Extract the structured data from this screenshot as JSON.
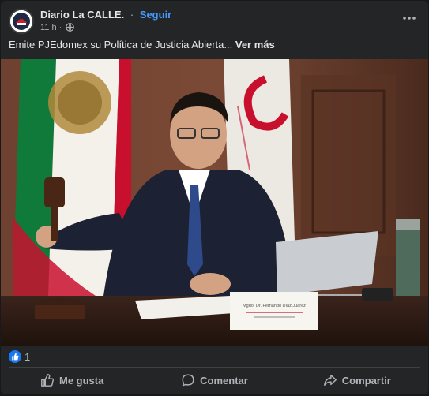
{
  "post": {
    "page_name": "Diario La CALLE.",
    "separator": "·",
    "follow_label": "Seguir",
    "time": "11 h",
    "time_separator": "·",
    "caption": "Emite PJEdomex su Política de Justicia Abierta...",
    "see_more": "Ver más",
    "more_icon": "more-horizontal-icon",
    "privacy_icon": "globe-icon"
  },
  "photo": {
    "nameplate_line1": "Mgdo. Dr. Fernando Díaz Juárez",
    "flag_colors": [
      "#0f7a3a",
      "#ffffff",
      "#c8102e"
    ],
    "wall_color": "#5b3322"
  },
  "reactions": {
    "icon": "like-reaction-icon",
    "count": "1"
  },
  "actions": {
    "like": "Me gusta",
    "comment": "Comentar",
    "share": "Compartir"
  },
  "colors": {
    "background": "#242526",
    "text": "#e4e6eb",
    "secondary_text": "#b0b3b8",
    "link": "#4599ff",
    "like_blue": "#1877f2"
  }
}
